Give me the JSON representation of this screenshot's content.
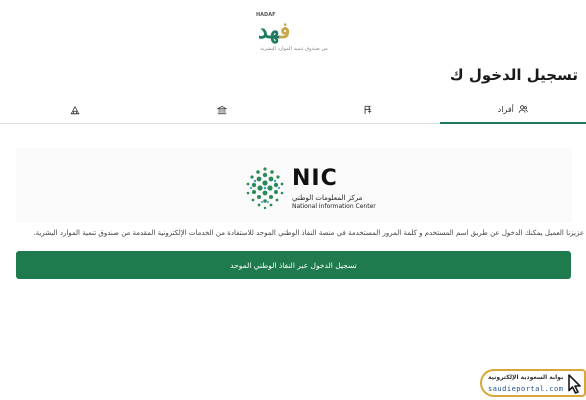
{
  "header": {
    "logo_en": "HADAF",
    "logo_ar_main": "هد",
    "logo_ar_accent": "ف",
    "logo_tagline": "من صندوق تنمية الموارد البشرية"
  },
  "page": {
    "title": "تسجيل الدخول ك"
  },
  "tabs": [
    {
      "label": "أفراد",
      "icon": "users-icon",
      "active": true
    },
    {
      "label": "",
      "icon": "flag-icon",
      "active": false
    },
    {
      "label": "",
      "icon": "bank-icon",
      "active": false
    },
    {
      "label": "",
      "icon": "building-icon",
      "active": false
    }
  ],
  "nic": {
    "name_en_short": "NIC",
    "name_ar": "مركز المعلومات الوطني",
    "name_en": "National Information Center"
  },
  "description": "عزيزنا العميل يمكنك الدخول عن طريق اسم المستخدم و كلمة المرور المستخدمة في منصة النفاذ الوطني الموحد للاستفادة من الخدمات الإلكترونية المقدمة من صندوق تنمية الموارد البشرية.",
  "login_button": {
    "label": "تسجيل الدخول عبر النفاذ الوطني الموحد"
  },
  "watermark": {
    "title_ar": "بوابة السعودية الإلكترونية",
    "url": "saudieportal.com"
  },
  "colors": {
    "primary": "#1f7a4e",
    "tab_active": "#1f7a5a",
    "logo_green": "#1f7a63",
    "logo_gold": "#c7a64c",
    "watermark_border": "#d9a63a"
  }
}
